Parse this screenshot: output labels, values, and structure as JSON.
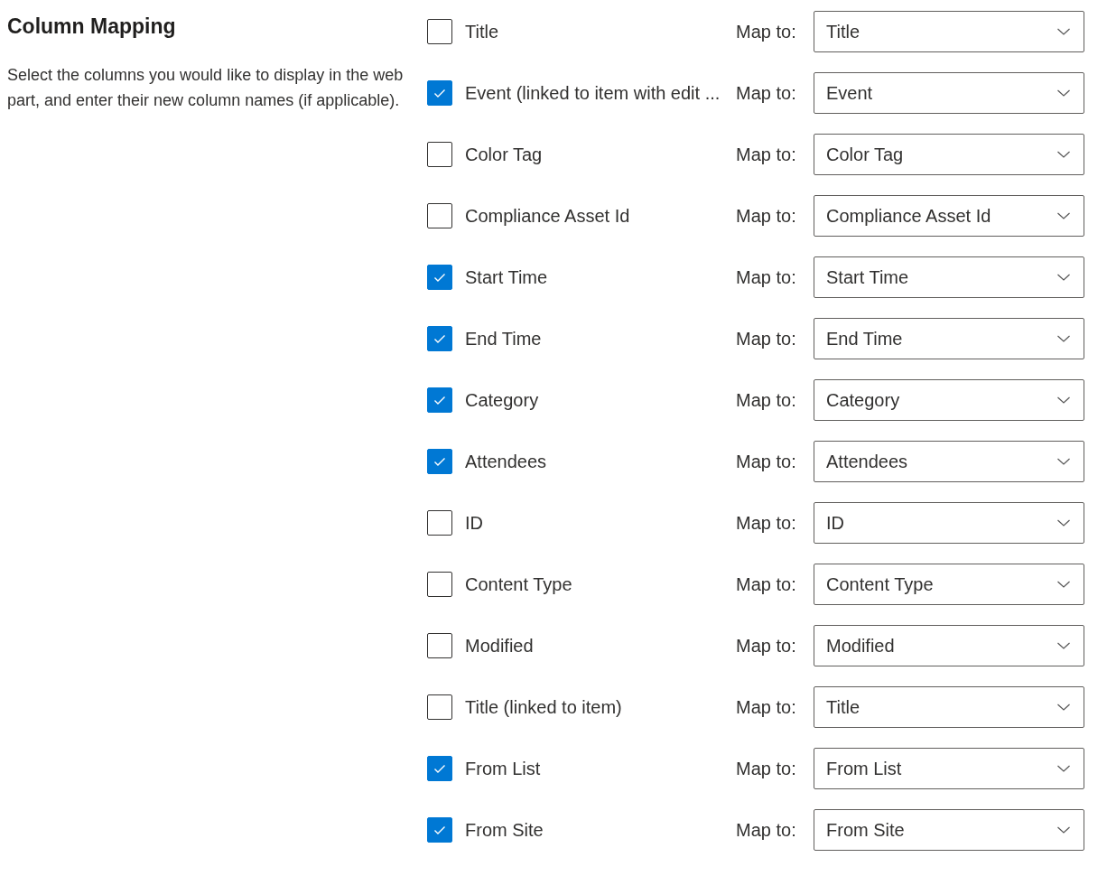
{
  "section": {
    "title": "Column Mapping",
    "description": "Select the columns you would like to display in the web part, and enter their new column names (if applicable)."
  },
  "columns": [
    {
      "label": "Title",
      "checked": false,
      "map_label": "Map to:",
      "mapped": "Title"
    },
    {
      "label": "Event (linked to item with edit ...",
      "checked": true,
      "map_label": "Map to:",
      "mapped": "Event"
    },
    {
      "label": "Color Tag",
      "checked": false,
      "map_label": "Map to:",
      "mapped": "Color Tag"
    },
    {
      "label": "Compliance Asset Id",
      "checked": false,
      "map_label": "Map to:",
      "mapped": "Compliance Asset Id"
    },
    {
      "label": "Start Time",
      "checked": true,
      "map_label": "Map to:",
      "mapped": "Start Time"
    },
    {
      "label": "End Time",
      "checked": true,
      "map_label": "Map to:",
      "mapped": "End Time"
    },
    {
      "label": "Category",
      "checked": true,
      "map_label": "Map to:",
      "mapped": "Category"
    },
    {
      "label": "Attendees",
      "checked": true,
      "map_label": "Map to:",
      "mapped": "Attendees"
    },
    {
      "label": "ID",
      "checked": false,
      "map_label": "Map to:",
      "mapped": "ID"
    },
    {
      "label": "Content Type",
      "checked": false,
      "map_label": "Map to:",
      "mapped": "Content Type"
    },
    {
      "label": "Modified",
      "checked": false,
      "map_label": "Map to:",
      "mapped": "Modified"
    },
    {
      "label": "Title (linked to item)",
      "checked": false,
      "map_label": "Map to:",
      "mapped": "Title"
    },
    {
      "label": "From List",
      "checked": true,
      "map_label": "Map to:",
      "mapped": "From List"
    },
    {
      "label": "From Site",
      "checked": true,
      "map_label": "Map to:",
      "mapped": "From Site"
    }
  ]
}
